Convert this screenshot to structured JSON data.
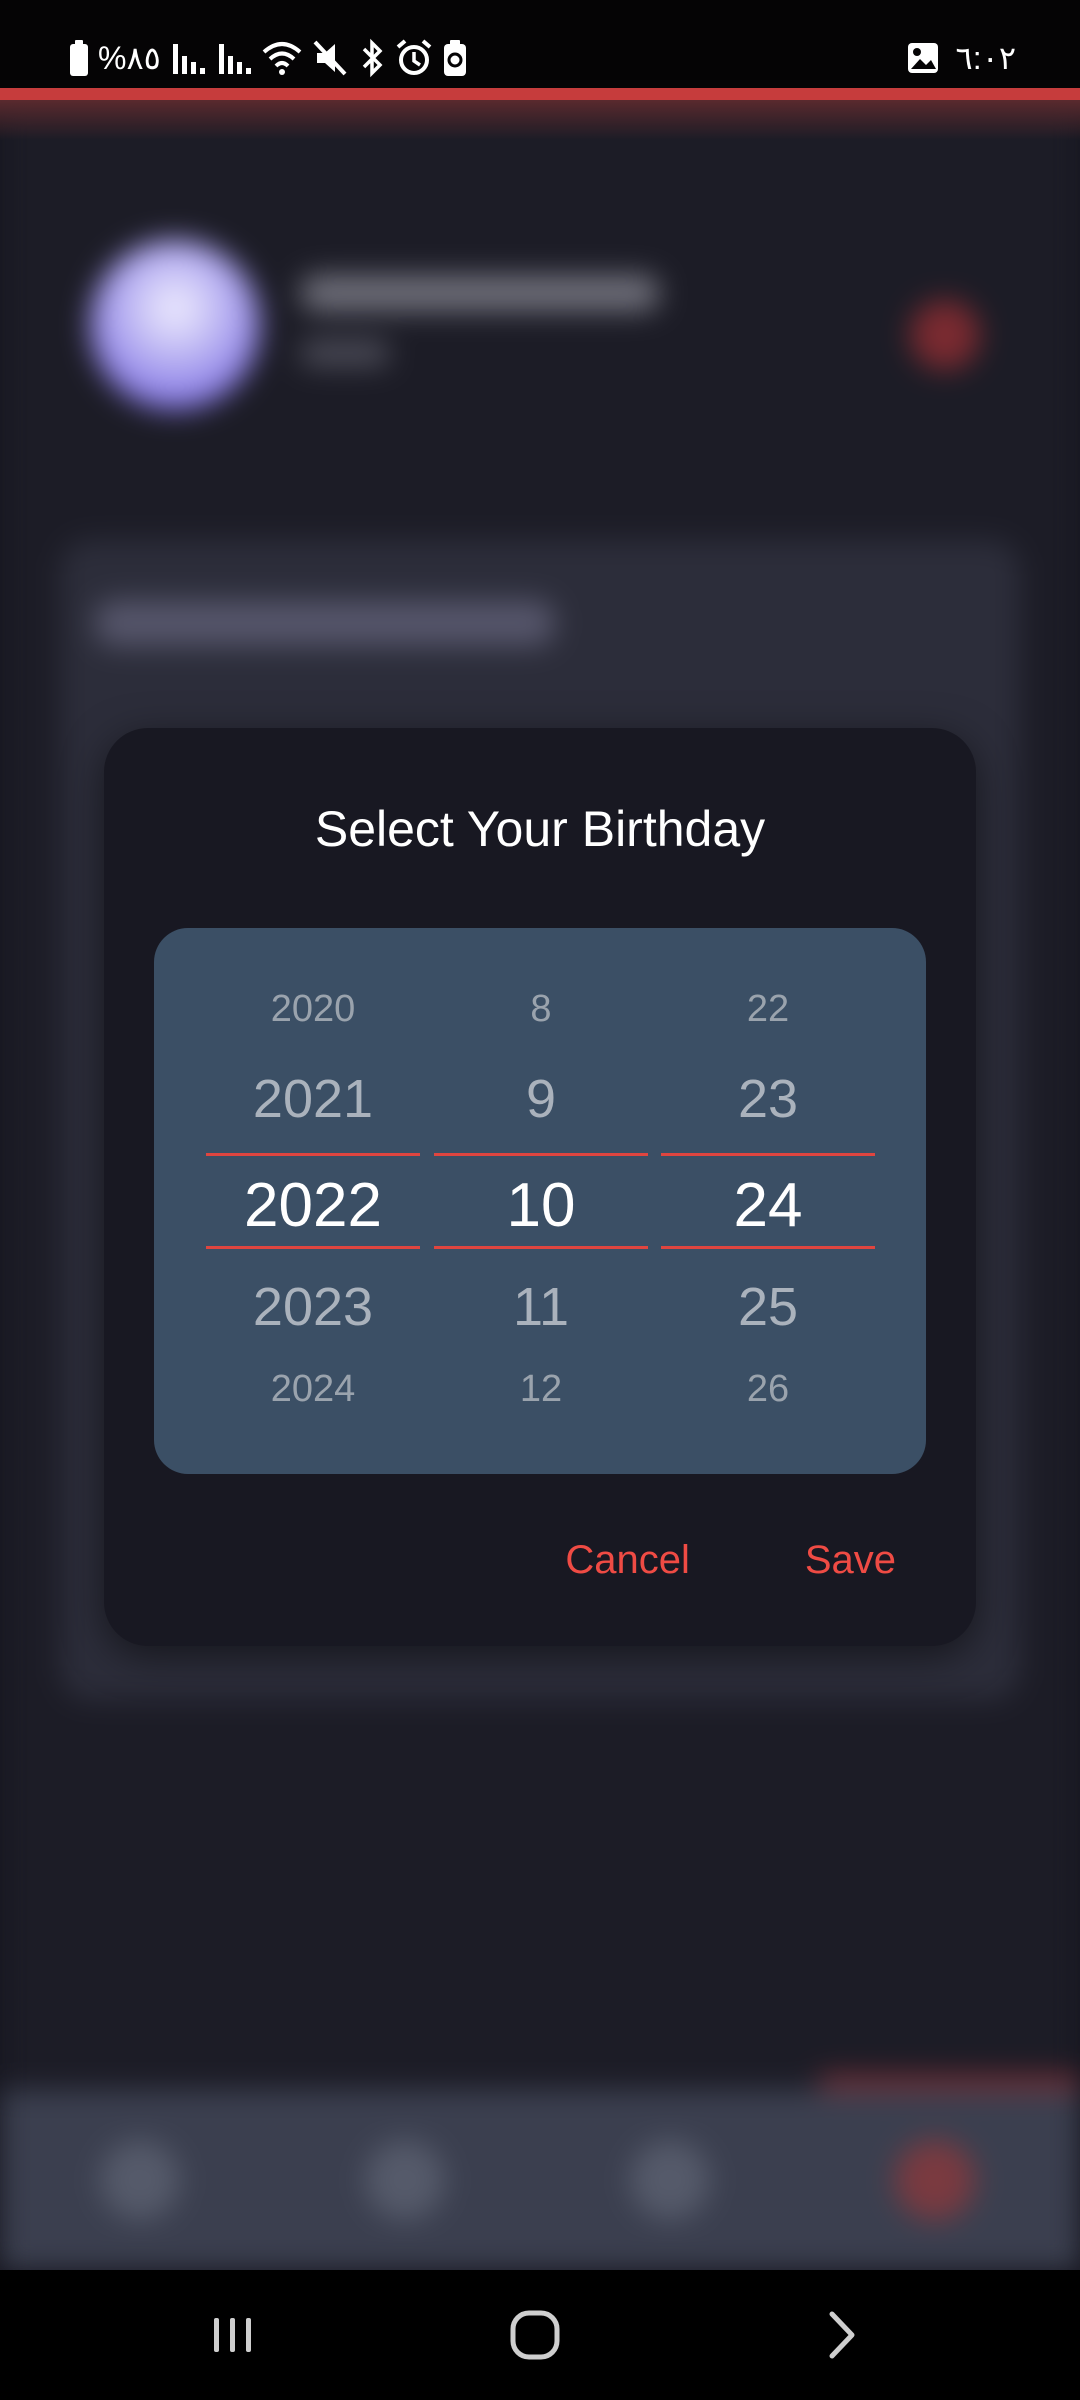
{
  "status_bar": {
    "battery_percent": "%٨٥",
    "time": "٦:٠٢"
  },
  "dialog": {
    "title": "Select Your Birthday",
    "cancel_label": "Cancel",
    "save_label": "Save",
    "picker": {
      "years": [
        "2020",
        "2021",
        "2022",
        "2023",
        "2024"
      ],
      "months": [
        "8",
        "9",
        "10",
        "11",
        "12"
      ],
      "days": [
        "22",
        "23",
        "24",
        "25",
        "26"
      ],
      "selected": {
        "year": "2022",
        "month": "10",
        "day": "24"
      }
    }
  },
  "colors": {
    "accent": "#ef4b44",
    "dialog_bg": "#181822",
    "picker_bg": "#3b4f65",
    "selected_text": "#ffffff",
    "unselected_text": "#a9b1bb"
  },
  "icons": {
    "status_left": [
      "battery-icon",
      "signal-icon",
      "signal-icon",
      "wifi-icon",
      "mute-icon",
      "bluetooth-icon",
      "alarm-icon",
      "battery-saver-icon"
    ],
    "status_right": [
      "gallery-notification-icon"
    ],
    "system_nav": [
      "recents-icon",
      "home-icon",
      "back-icon"
    ]
  }
}
